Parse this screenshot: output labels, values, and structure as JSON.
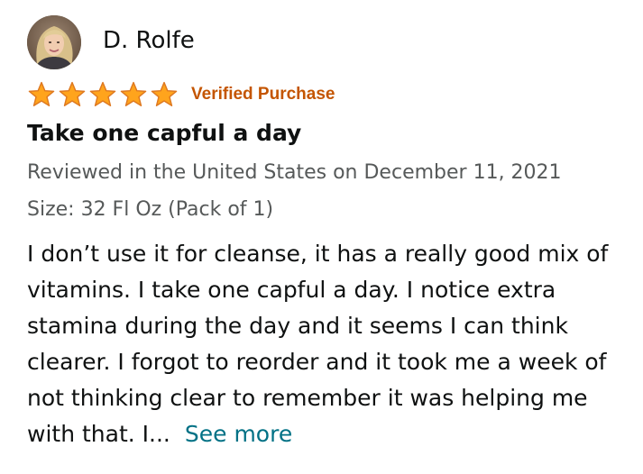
{
  "reviewer": {
    "name": "D. Rolfe",
    "avatar_icon": "profile-photo"
  },
  "rating": {
    "stars": 5,
    "max": 5,
    "star_color": "#ffa41c",
    "star_outline": "#de7921"
  },
  "badge": {
    "label": "Verified Purchase",
    "color": "#c45500"
  },
  "review": {
    "title": "Take one capful a day",
    "date_line": "Reviewed in the United States on December 11, 2021",
    "variant": "Size: 32 Fl Oz (Pack of 1)",
    "body": "I don’t use it for cleanse, it has a really good mix of vitamins. I take one capful a day. I notice extra stamina during the day and it seems I can think clearer. I forgot to reorder and it took me a week of not thinking clear to remember it was helping me with that. I...",
    "see_more": "See more",
    "link_color": "#007185"
  }
}
